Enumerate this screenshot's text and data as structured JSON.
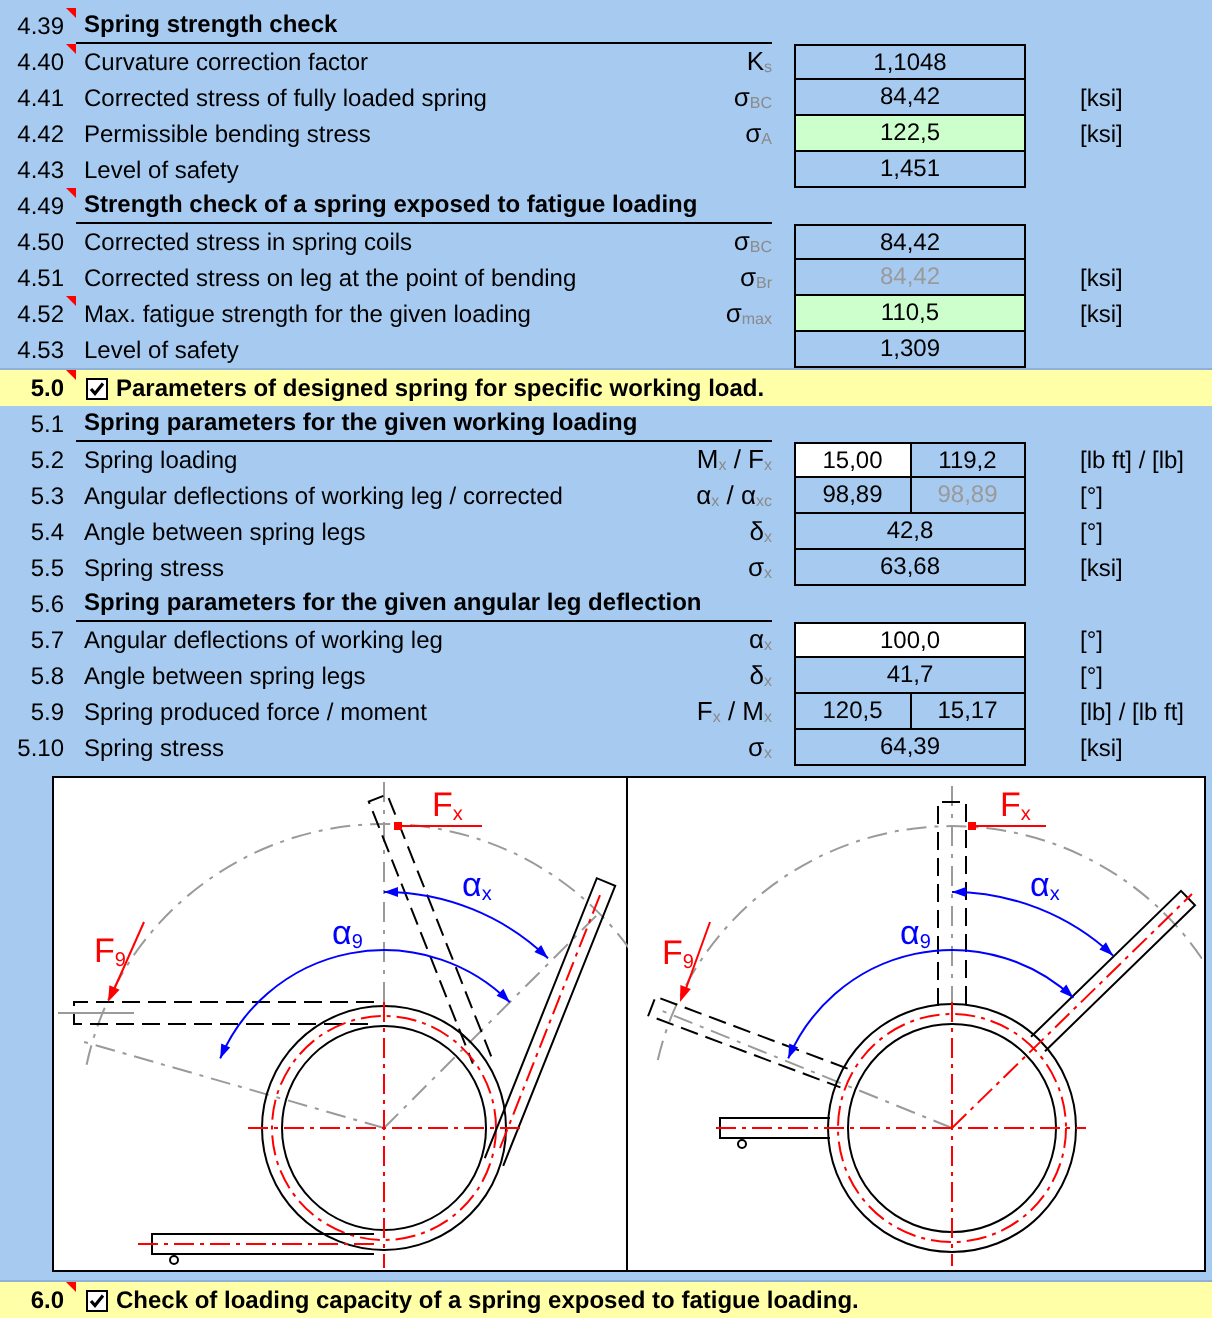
{
  "rows": [
    {
      "kind": "heading",
      "number": "4.39",
      "title": "Spring strength check",
      "comment": true
    },
    {
      "kind": "param",
      "number": "4.40",
      "label": "Curvature correction factor",
      "symbol": "K$_{s}$",
      "values": [
        {
          "text": "1,1048",
          "kind": "result",
          "disabled": false
        }
      ],
      "comment": true
    },
    {
      "kind": "param",
      "number": "4.41",
      "label": "Corrected stress of fully loaded spring",
      "symbol": "σ$_{BC}$",
      "values": [
        {
          "text": "84,42",
          "kind": "result",
          "disabled": false
        }
      ],
      "unit": "[ksi]",
      "comment": false
    },
    {
      "kind": "param",
      "number": "4.42",
      "label": "Permissible bending stress",
      "symbol": "σ$_{A}$",
      "values": [
        {
          "text": "122,5",
          "kind": "highlighted",
          "disabled": false
        }
      ],
      "unit": "[ksi]",
      "comment": false
    },
    {
      "kind": "param",
      "number": "4.43",
      "label": "Level of safety",
      "values": [
        {
          "text": "1,451",
          "kind": "result",
          "disabled": false
        }
      ],
      "comment": false
    },
    {
      "kind": "heading",
      "number": "4.49",
      "title": "Strength check of a spring exposed to fatigue loading",
      "comment": true
    },
    {
      "kind": "param",
      "number": "4.50",
      "label": "Corrected stress in spring coils",
      "symbol": "σ$_{BC}$",
      "values": [
        {
          "text": "84,42",
          "kind": "result",
          "disabled": false
        }
      ],
      "comment": false
    },
    {
      "kind": "param",
      "number": "4.51",
      "label": "Corrected stress on leg at the point of bending",
      "symbol": "σ$_{Br}$",
      "values": [
        {
          "text": "84,42",
          "kind": "result",
          "disabled": true
        }
      ],
      "unit": "[ksi]",
      "comment": false
    },
    {
      "kind": "param",
      "number": "4.52",
      "label": "Max. fatigue strength for the given loading",
      "symbol": "σ$_{max}$",
      "values": [
        {
          "text": "110,5",
          "kind": "highlighted",
          "disabled": false
        }
      ],
      "unit": "[ksi]",
      "comment": true
    },
    {
      "kind": "param",
      "number": "4.53",
      "label": "Level of safety",
      "values": [
        {
          "text": "1,309",
          "kind": "result",
          "disabled": false
        }
      ],
      "comment": false
    },
    {
      "kind": "chapter",
      "number": "5.0",
      "title": "Parameters of designed spring for specific working load.",
      "checked": true,
      "comment": true
    },
    {
      "kind": "heading",
      "number": "5.1",
      "title": "Spring parameters for the given working loading",
      "comment": false
    },
    {
      "kind": "param",
      "number": "5.2",
      "label": "Spring loading",
      "symbol": "M$_{x}$ / F$_{x}$",
      "values": [
        {
          "text": "15,00",
          "kind": "input",
          "disabled": false
        },
        {
          "text": "119,2",
          "kind": "result",
          "disabled": false
        }
      ],
      "unit": "[lb ft] / [lb]",
      "comment": false
    },
    {
      "kind": "param",
      "number": "5.3",
      "label": "Angular deflections of working leg / corrected",
      "symbol": "α$_{x}$ / α$_{xc}$",
      "values": [
        {
          "text": "98,89",
          "kind": "result",
          "disabled": false
        },
        {
          "text": "98,89",
          "kind": "result",
          "disabled": true
        }
      ],
      "unit": "[°]",
      "comment": false
    },
    {
      "kind": "param",
      "number": "5.4",
      "label": "Angle between spring legs",
      "symbol": "δ$_{x}$",
      "values": [
        {
          "text": "42,8",
          "kind": "result",
          "disabled": false
        }
      ],
      "unit": "[°]",
      "comment": false
    },
    {
      "kind": "param",
      "number": "5.5",
      "label": "Spring stress",
      "symbol": "σ$_{x}$",
      "values": [
        {
          "text": "63,68",
          "kind": "result",
          "disabled": false
        }
      ],
      "unit": "[ksi]",
      "comment": false
    },
    {
      "kind": "heading",
      "number": "5.6",
      "title": "Spring parameters for the given angular leg deflection",
      "comment": false
    },
    {
      "kind": "param",
      "number": "5.7",
      "label": "Angular deflections of working leg",
      "symbol": "α$_{x}$",
      "values": [
        {
          "text": "100,0",
          "kind": "input",
          "disabled": false
        }
      ],
      "unit": "[°]",
      "comment": false
    },
    {
      "kind": "param",
      "number": "5.8",
      "label": "Angle between spring legs",
      "symbol": "δ$_{x}$",
      "values": [
        {
          "text": "41,7",
          "kind": "result",
          "disabled": false
        }
      ],
      "unit": "[°]",
      "comment": false
    },
    {
      "kind": "param",
      "number": "5.9",
      "label": "Spring produced force / moment",
      "symbol": "F$_{x}$ / M$_{x}$",
      "values": [
        {
          "text": "120,5",
          "kind": "result",
          "disabled": false
        },
        {
          "text": "15,17",
          "kind": "result",
          "disabled": false
        }
      ],
      "unit": "[lb] / [lb ft]",
      "comment": false
    },
    {
      "kind": "param",
      "number": "5.10",
      "label": "Spring stress",
      "symbol": "σ$_{x}$",
      "values": [
        {
          "text": "64,39",
          "kind": "result",
          "disabled": false
        }
      ],
      "unit": "[ksi]",
      "comment": false
    },
    {
      "kind": "figure",
      "panels": [
        {
          "kind": "tangent-legs",
          "labels": [
            {
              "text": "F$_{x}$",
              "kind": "force"
            },
            {
              "text": "α$_{x}$",
              "kind": "angle"
            },
            {
              "text": "F$_{9}$",
              "kind": "force"
            },
            {
              "text": "α$_{9}$",
              "kind": "angle"
            }
          ]
        },
        {
          "kind": "bent-legs",
          "labels": [
            {
              "text": "F$_{x}$",
              "kind": "force"
            },
            {
              "text": "α$_{x}$",
              "kind": "angle"
            },
            {
              "text": "F$_{9}$",
              "kind": "force"
            },
            {
              "text": "α$_{9}$",
              "kind": "angle"
            }
          ]
        }
      ]
    },
    {
      "kind": "chapter",
      "number": "6.0",
      "title": "Check of loading capacity of a spring exposed to fatigue loading.",
      "checked": true,
      "comment": true
    }
  ]
}
